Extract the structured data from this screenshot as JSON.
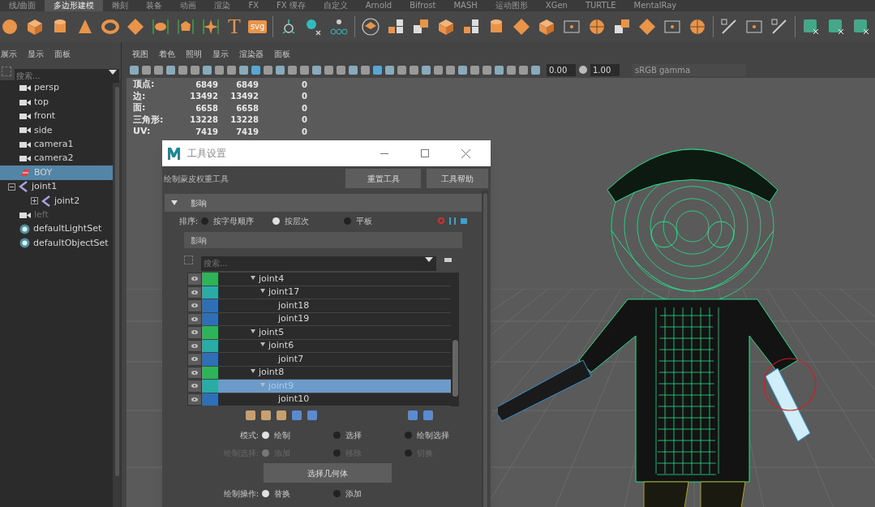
{
  "shelf": {
    "tabs": [
      {
        "label": "线/曲面",
        "selected": false
      },
      {
        "label": "多边形建模",
        "selected": true
      },
      {
        "label": "雕刻",
        "selected": false
      },
      {
        "label": "装备",
        "selected": false
      },
      {
        "label": "动画",
        "selected": false
      },
      {
        "label": "渲染",
        "selected": false
      },
      {
        "label": "FX",
        "selected": false
      },
      {
        "label": "FX 缓存",
        "selected": false
      },
      {
        "label": "自定义",
        "selected": false
      },
      {
        "label": "Arnold",
        "selected": false
      },
      {
        "label": "Bifrost",
        "selected": false
      },
      {
        "label": "MASH",
        "selected": false
      },
      {
        "label": "运动图形",
        "selected": false
      },
      {
        "label": "XGen",
        "selected": false
      },
      {
        "label": "TURTLE",
        "selected": false
      },
      {
        "label": "MentalRay",
        "selected": false
      }
    ],
    "text_tool_glyph": "T",
    "svg_tool_label": "svg"
  },
  "outliner": {
    "menu": [
      "展示",
      "显示",
      "面板"
    ],
    "search": {
      "placeholder": "搜索..."
    },
    "items": [
      {
        "name": "persp",
        "kind": "camera",
        "selected": false,
        "dimmed": false
      },
      {
        "name": "top",
        "kind": "camera",
        "selected": false,
        "dimmed": false
      },
      {
        "name": "front",
        "kind": "camera",
        "selected": false,
        "dimmed": false
      },
      {
        "name": "side",
        "kind": "camera",
        "selected": false,
        "dimmed": false
      },
      {
        "name": "camera1",
        "kind": "camera",
        "selected": false,
        "dimmed": false
      },
      {
        "name": "camera2",
        "kind": "camera",
        "selected": false,
        "dimmed": false
      },
      {
        "name": "BOY",
        "kind": "mesh",
        "selected": true,
        "dimmed": false
      },
      {
        "name": "joint1",
        "kind": "joint",
        "selected": false,
        "dimmed": false,
        "expanded": true,
        "children": [
          {
            "name": "joint2",
            "kind": "joint",
            "selected": false,
            "dimmed": false,
            "expanded": false
          }
        ]
      },
      {
        "name": "left",
        "kind": "camera",
        "selected": false,
        "dimmed": true
      },
      {
        "name": "defaultLightSet",
        "kind": "set",
        "selected": false,
        "dimmed": false
      },
      {
        "name": "defaultObjectSet",
        "kind": "set",
        "selected": false,
        "dimmed": false
      }
    ]
  },
  "viewport": {
    "menu": [
      "视图",
      "着色",
      "照明",
      "显示",
      "渲染器",
      "面板"
    ],
    "exposure": "0.00",
    "gamma": "1.00",
    "color_space": "sRGB gamma",
    "stats": [
      {
        "label": "顶点:",
        "values": [
          "6849",
          "6849",
          "0"
        ]
      },
      {
        "label": "边:",
        "values": [
          "13492",
          "13492",
          "0"
        ]
      },
      {
        "label": "面:",
        "values": [
          "6658",
          "6658",
          "0"
        ]
      },
      {
        "label": "三角形:",
        "values": [
          "13228",
          "13228",
          "0"
        ]
      },
      {
        "label": "UV:",
        "values": [
          "7419",
          "7419",
          "0"
        ]
      }
    ]
  },
  "tool_settings": {
    "title": "工具设置",
    "tool_name": "绘制蒙皮权重工具",
    "buttons": [
      "重置工具",
      "工具帮助"
    ],
    "section": {
      "title": "影响",
      "expanded": true
    },
    "sort": {
      "label": "排序:",
      "disabled": false,
      "options": [
        {
          "label": "按字母顺序",
          "selected": false
        },
        {
          "label": "按层次",
          "selected": true
        },
        {
          "label": "平板",
          "selected": false
        }
      ]
    },
    "influences_header": "影响",
    "search": {
      "placeholder": "搜索..."
    },
    "joints": [
      {
        "name": "joint4",
        "color": "#2fb35a",
        "selected": false,
        "expanded": true,
        "children": [
          {
            "name": "joint17",
            "color": "#2aaba6",
            "selected": false,
            "expanded": true,
            "children": [
              {
                "name": "joint18",
                "color": "#2f6fb5",
                "selected": false
              },
              {
                "name": "joint19",
                "color": "#2f6fb5",
                "selected": false
              }
            ]
          }
        ]
      },
      {
        "name": "joint5",
        "color": "#2fb35a",
        "selected": false,
        "expanded": true,
        "children": [
          {
            "name": "joint6",
            "color": "#2aaba6",
            "selected": false,
            "expanded": true,
            "children": [
              {
                "name": "joint7",
                "color": "#2f6fb5",
                "selected": false
              }
            ]
          }
        ]
      },
      {
        "name": "joint8",
        "color": "#2fb35a",
        "selected": false,
        "expanded": true,
        "children": [
          {
            "name": "joint9",
            "color": "#2aaba6",
            "selected": true,
            "expanded": true,
            "children": [
              {
                "name": "joint10",
                "color": "#2f6fb5",
                "selected": false
              }
            ]
          }
        ]
      }
    ],
    "mode": {
      "label": "模式:",
      "disabled": false,
      "options": [
        {
          "label": "绘制",
          "selected": true
        },
        {
          "label": "选择",
          "selected": false
        },
        {
          "label": "绘制选择",
          "selected": false
        }
      ]
    },
    "paint_select": {
      "label": "绘制选择:",
      "disabled": true,
      "options": [
        {
          "label": "添加",
          "selected": true
        },
        {
          "label": "移除",
          "selected": false
        },
        {
          "label": "切换",
          "selected": false
        }
      ]
    },
    "select_geometry_button": "选择几何体",
    "paint_operation": {
      "label": "绘制操作:",
      "disabled": false,
      "options": [
        {
          "label": "替换",
          "selected": true
        },
        {
          "label": "添加",
          "selected": false
        }
      ]
    }
  }
}
